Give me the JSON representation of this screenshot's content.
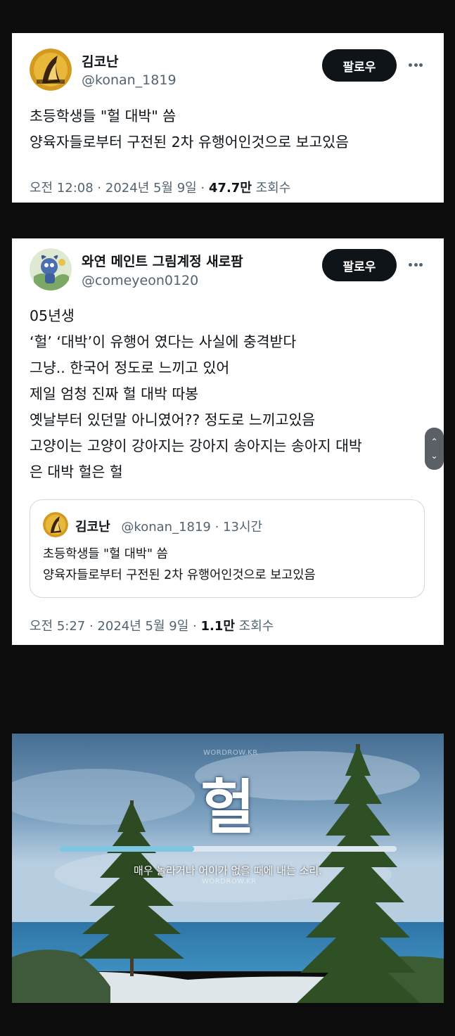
{
  "tweet1": {
    "author_name": "김코난",
    "author_handle": "@konan_1819",
    "follow_label": "팔로우",
    "body_lines": [
      "초등학생들 \"헐 대박\" 씀",
      "양육자들로부터 구전된 2차 유행어인것으로 보고있음"
    ],
    "time": "오전 12:08 · 2024년 5월 9일 ·",
    "views_count": "47.7만",
    "views_label": "조회수"
  },
  "tweet2": {
    "author_name": "와연 메인트 그림계정 새로팜",
    "author_handle": "@comeyeon0120",
    "follow_label": "팔로우",
    "body_lines": [
      "05년생",
      "‘헐’ ‘대박’이 유행어 였다는 사실에 충격받다",
      "그냥.. 한국어 정도로 느끼고 있어",
      "제일 엄청 진짜 헐 대박 따봉",
      "옛날부터 있던말 아니였어?? 정도로 느끼고있음",
      "고양이는 고양이 강아지는 강아지 송아지는 송아지 대박",
      "은 대박 헐은 헐"
    ],
    "quote": {
      "author_name": "김코난",
      "author_handle": "@konan_1819",
      "age": "· 13시간",
      "body_lines": [
        "초등학생들 \"헐 대박\" 씀",
        "양육자들로부터 구전된 2차 유행어인것으로 보고있음"
      ]
    },
    "time": "오전 5:27 · 2024년 5월 9일 ·",
    "views_count": "1.1만",
    "views_label": "조회수"
  },
  "scroll_buttons": {
    "up": "⌃",
    "down": "⌄"
  },
  "image_panel": {
    "watermark_top": "WORDROW.KR",
    "word": "헐",
    "definition": "매우 놀라거나 어이가 없을 때에 내는 소리.",
    "watermark_bottom": "WORDROW.KR",
    "progress_fraction": 0.4
  },
  "icons": {
    "more": "more-icon",
    "avatar1": "avatar-konan",
    "avatar2": "avatar-comeyeon"
  },
  "colors": {
    "follow_bg": "#0f1419",
    "secondary_text": "#536471",
    "quote_border": "#cfd9de",
    "progress_fill": "#7fc6e2"
  }
}
